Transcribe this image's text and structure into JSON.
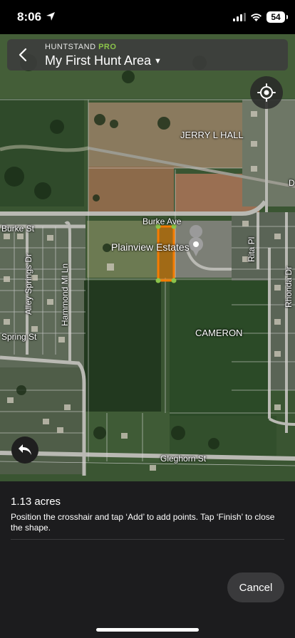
{
  "status_bar": {
    "time": "8:06",
    "battery": "54"
  },
  "header": {
    "brand": "HUNTSTAND",
    "brand_tier": "PRO",
    "title": "My First Hunt Area"
  },
  "map": {
    "labels": {
      "jerry_hall": "JERRY L HALL",
      "burke_ave": "Burke Ave",
      "burke_st": "Burke St",
      "plainview": "Plainview Estates",
      "cameron": "CAMERON",
      "alley_springs": "Alley Springs Dr",
      "hammond": "Hammond Ml Ln",
      "rita": "Rita Pl",
      "rhonda": "Rhonda Dr",
      "spring_st": "Spring St",
      "gleghorn": "Gleghorn St",
      "d_edge": "D"
    },
    "colors": {
      "boundary": "#f57c00",
      "vertex": "#8bc34a"
    }
  },
  "panel": {
    "acres": "1.13 acres",
    "instructions": "Position the crosshair and tap ‘Add’ to add points. Tap ‘Finish’ to close the shape.",
    "cancel_label": "Cancel"
  },
  "icons": {
    "back": "chevron-left-icon",
    "locate": "crosshair-icon",
    "undo": "undo-icon",
    "caret": "caret-down-icon"
  }
}
